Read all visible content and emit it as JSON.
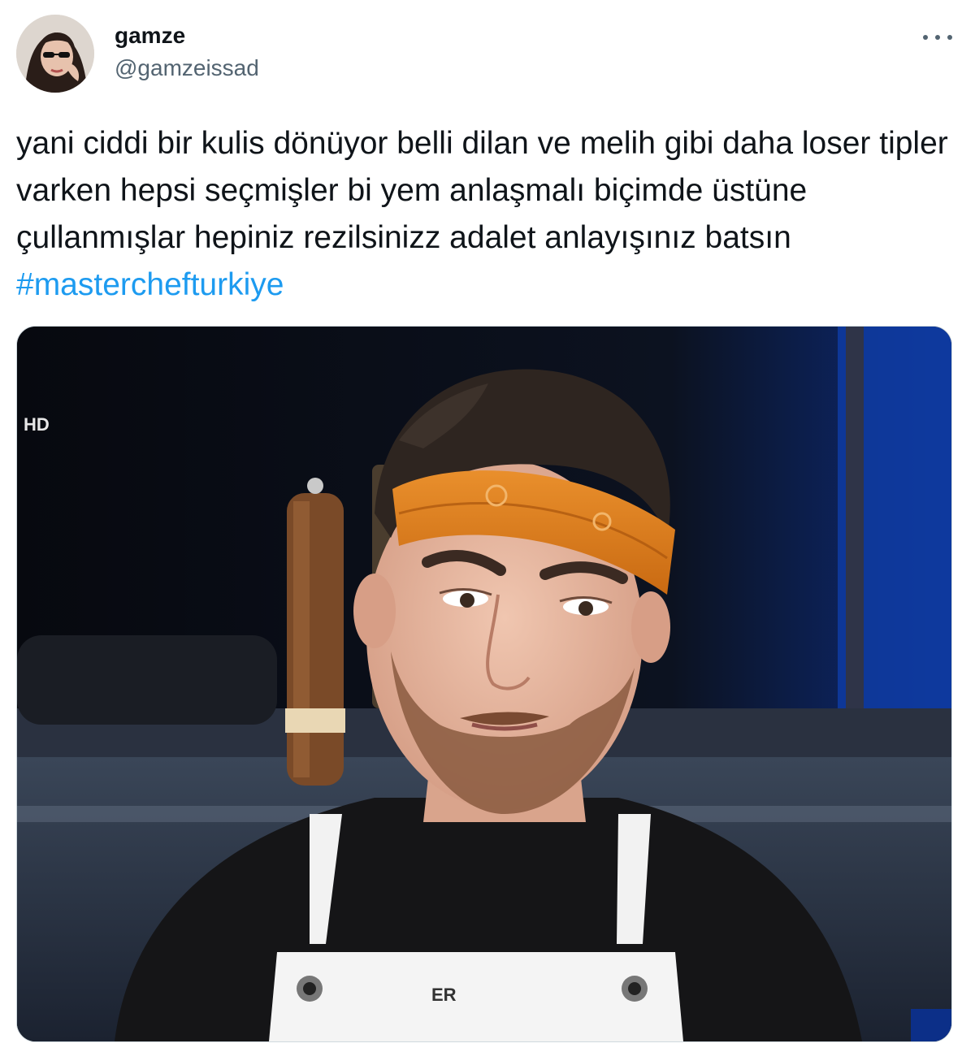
{
  "author": {
    "display_name": "gamze",
    "handle": "@gamzeissad"
  },
  "tweet": {
    "text_prefix": "yani ciddi bir kulis dönüyor belli dilan ve melih gibi daha loser tipler varken hepsi seçmişler bi yem anlaşmalı biçimde üstüne çullanmışlar hepiniz rezilsinizz adalet anlayışınız batsın ",
    "hashtag": "#masterchefturkiye"
  },
  "media": {
    "tv_badge": "HD",
    "apron_text": "ER"
  },
  "icons": {
    "more": "more-horizontal-icon"
  },
  "colors": {
    "link": "#1d9bf0",
    "secondary_text": "#536471",
    "primary_text": "#0f1419"
  }
}
